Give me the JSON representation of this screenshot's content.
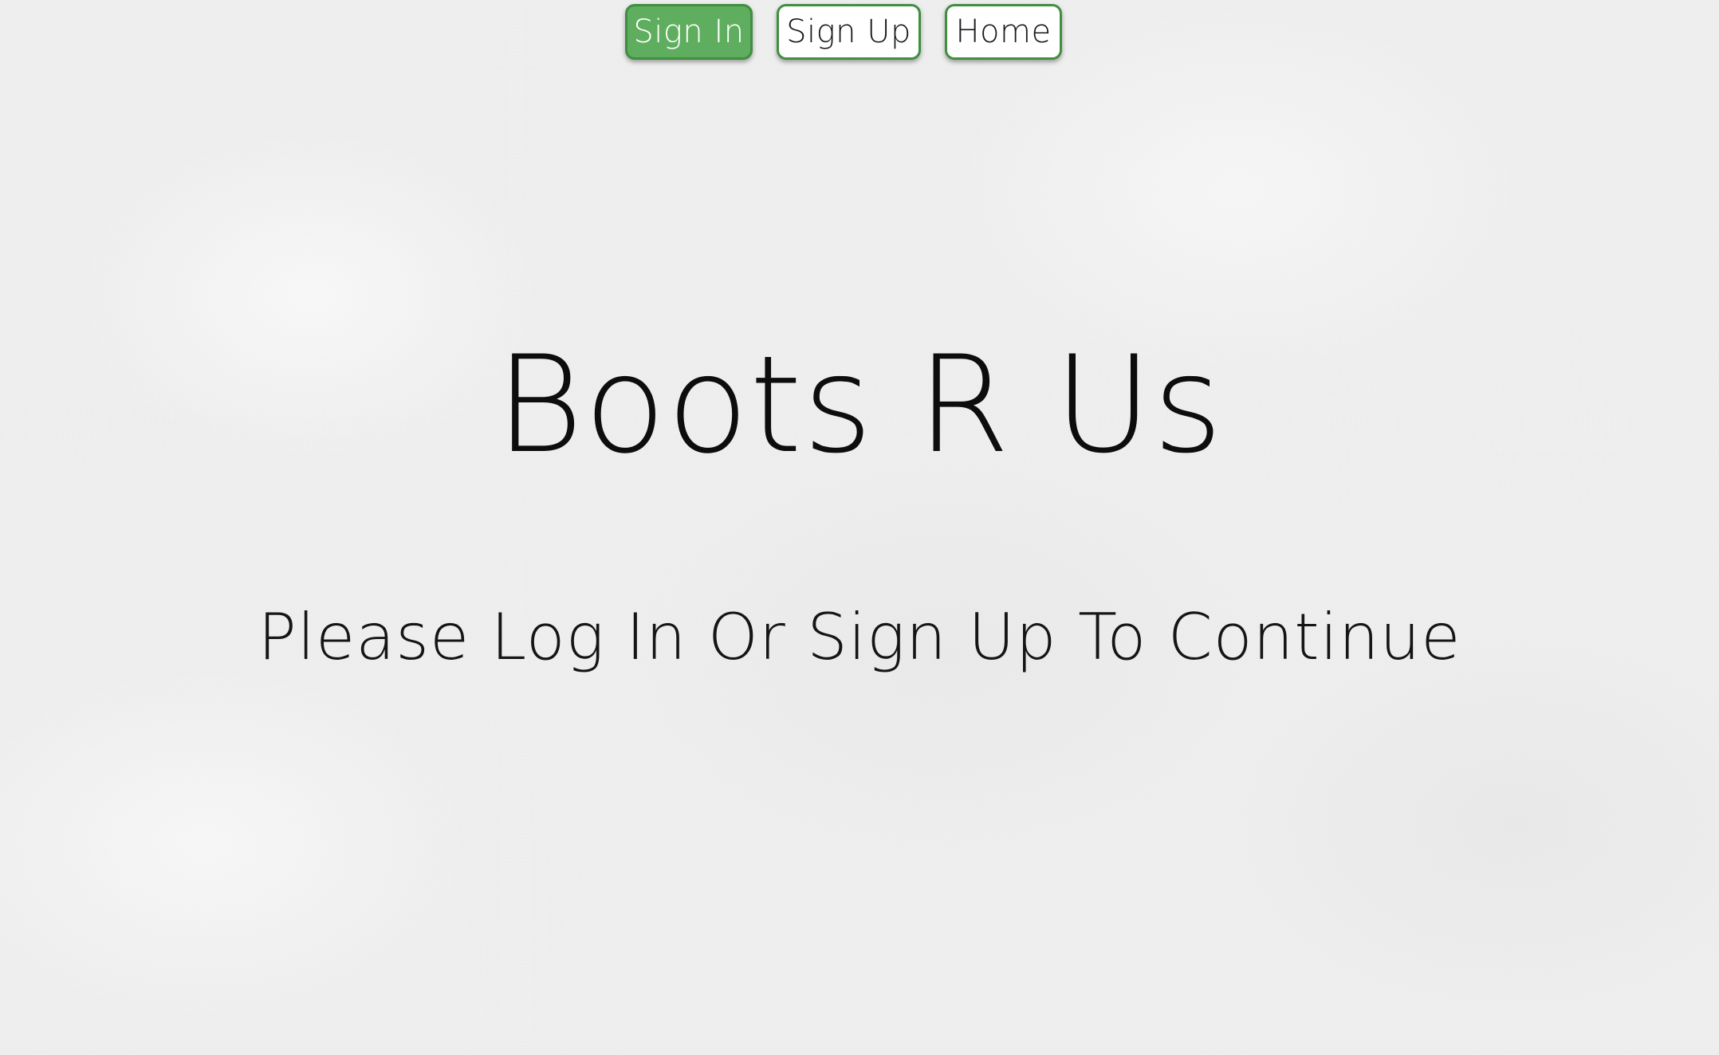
{
  "nav": {
    "items": [
      {
        "label": "Sign In",
        "active": true
      },
      {
        "label": "Sign Up",
        "active": false
      },
      {
        "label": "Home",
        "active": false
      }
    ]
  },
  "hero": {
    "title": "Boots R Us",
    "subtitle": "Please Log In Or Sign Up To Continue"
  },
  "colors": {
    "accent": "#5fae5f",
    "border": "#3f8f3f",
    "background": "#efefef",
    "text": "#111111"
  }
}
